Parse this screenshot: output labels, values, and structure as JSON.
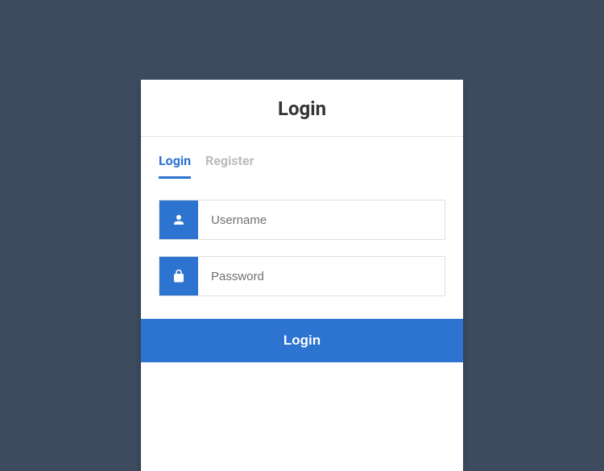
{
  "header": {
    "title": "Login"
  },
  "tabs": {
    "login": "Login",
    "register": "Register"
  },
  "form": {
    "username_placeholder": "Username",
    "password_placeholder": "Password"
  },
  "submit": {
    "label": "Login"
  },
  "colors": {
    "primary": "#2d73d0",
    "background": "#3d4b5f"
  }
}
